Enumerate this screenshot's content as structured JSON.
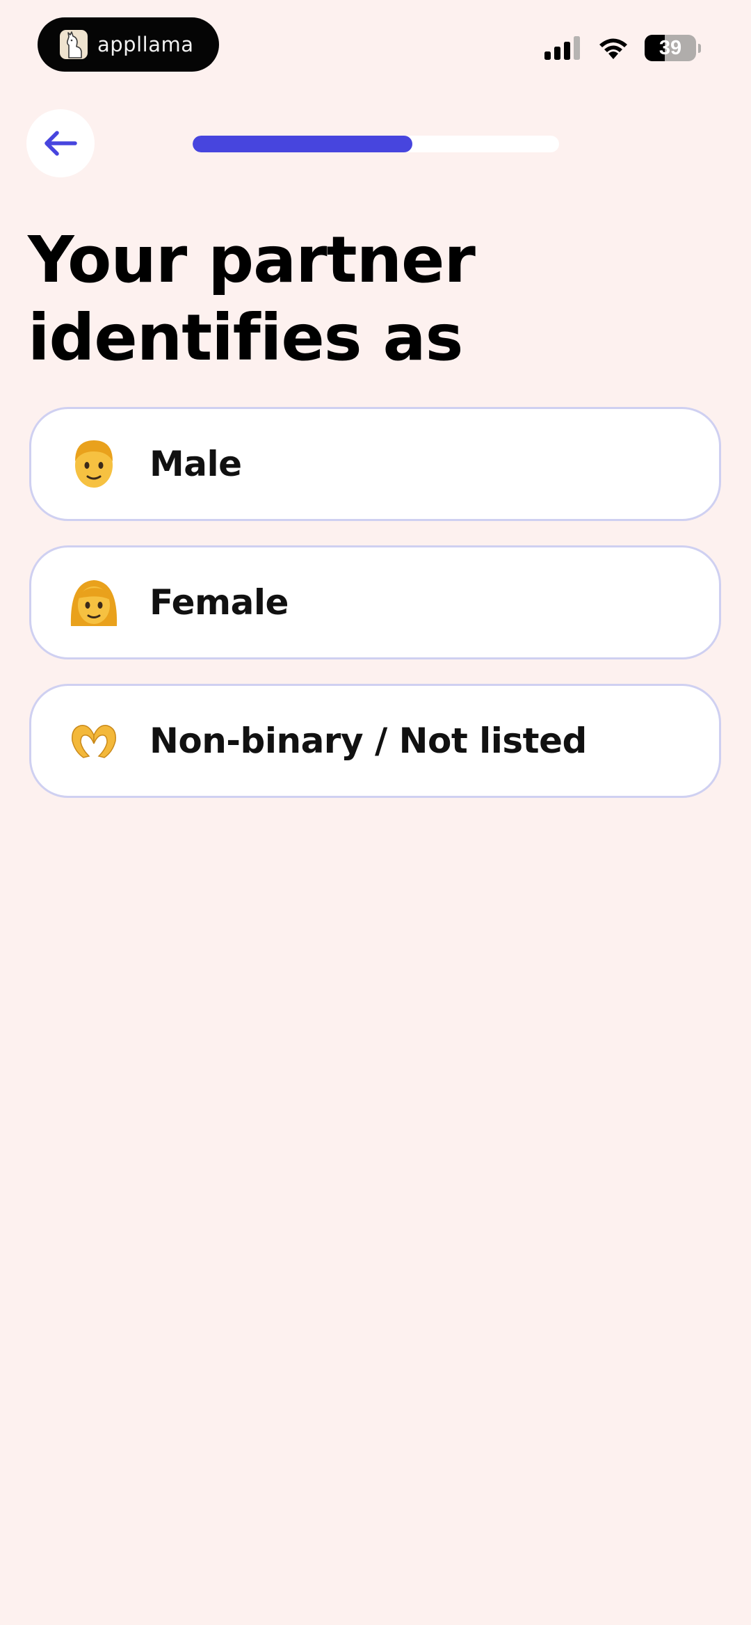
{
  "status_bar": {
    "app_badge_text": "appllama",
    "battery_level": "39",
    "battery_fraction": 0.39
  },
  "navigation": {
    "back_icon": "arrow-left-icon"
  },
  "progress": {
    "fraction": 0.6
  },
  "question": {
    "title": "Your partner identifies as"
  },
  "options": [
    {
      "icon": "man-face-icon",
      "label": "Male"
    },
    {
      "icon": "woman-face-icon",
      "label": "Female"
    },
    {
      "icon": "heart-hands-icon",
      "label": "Non-binary / Not listed"
    }
  ],
  "colors": {
    "background": "#fdf1ef",
    "accent": "#4745de",
    "card_border": "#cfd0f1",
    "card_fill": "#ffffff"
  }
}
